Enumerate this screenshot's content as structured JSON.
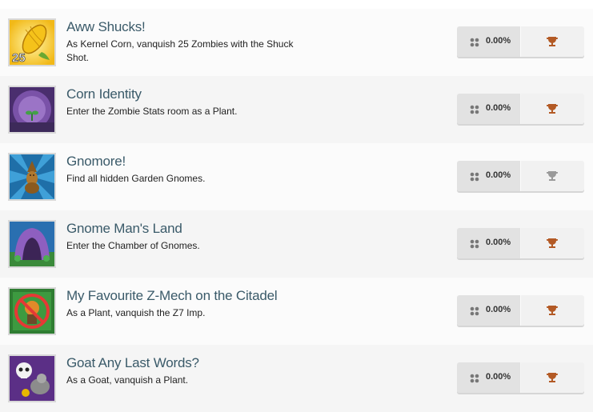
{
  "achievements": [
    {
      "title": "Aww Shucks!",
      "description": "As Kernel Corn, vanquish 25 Zombies with the Shuck Shot.",
      "percent": "0.00%",
      "trophy_tier": "bronze",
      "trophy_color": "#b35a25",
      "badge_number": "25",
      "image_icon": "corn-icon"
    },
    {
      "title": "Corn Identity",
      "description": "Enter the Zombie Stats room as a Plant.",
      "percent": "0.00%",
      "trophy_tier": "bronze",
      "trophy_color": "#b35a25",
      "image_icon": "purple-room-icon"
    },
    {
      "title": "Gnomore!",
      "description": "Find all hidden Garden Gnomes.",
      "percent": "0.00%",
      "trophy_tier": "silver",
      "trophy_color": "#9a9a9a",
      "image_icon": "garden-gnome-icon"
    },
    {
      "title": "Gnome Man's Land",
      "description": "Enter the Chamber of Gnomes.",
      "percent": "0.00%",
      "trophy_tier": "bronze",
      "trophy_color": "#b35a25",
      "image_icon": "cave-icon"
    },
    {
      "title": "My Favourite Z-Mech on the Citadel",
      "description": "As a Plant, vanquish the Z7 Imp.",
      "percent": "0.00%",
      "trophy_tier": "bronze",
      "trophy_color": "#b35a25",
      "image_icon": "no-imp-icon"
    },
    {
      "title": "Goat Any Last Words?",
      "description": "As a Goat, vanquish a Plant.",
      "percent": "0.00%",
      "trophy_tier": "bronze",
      "trophy_color": "#b35a25",
      "image_icon": "goat-skull-icon"
    }
  ]
}
